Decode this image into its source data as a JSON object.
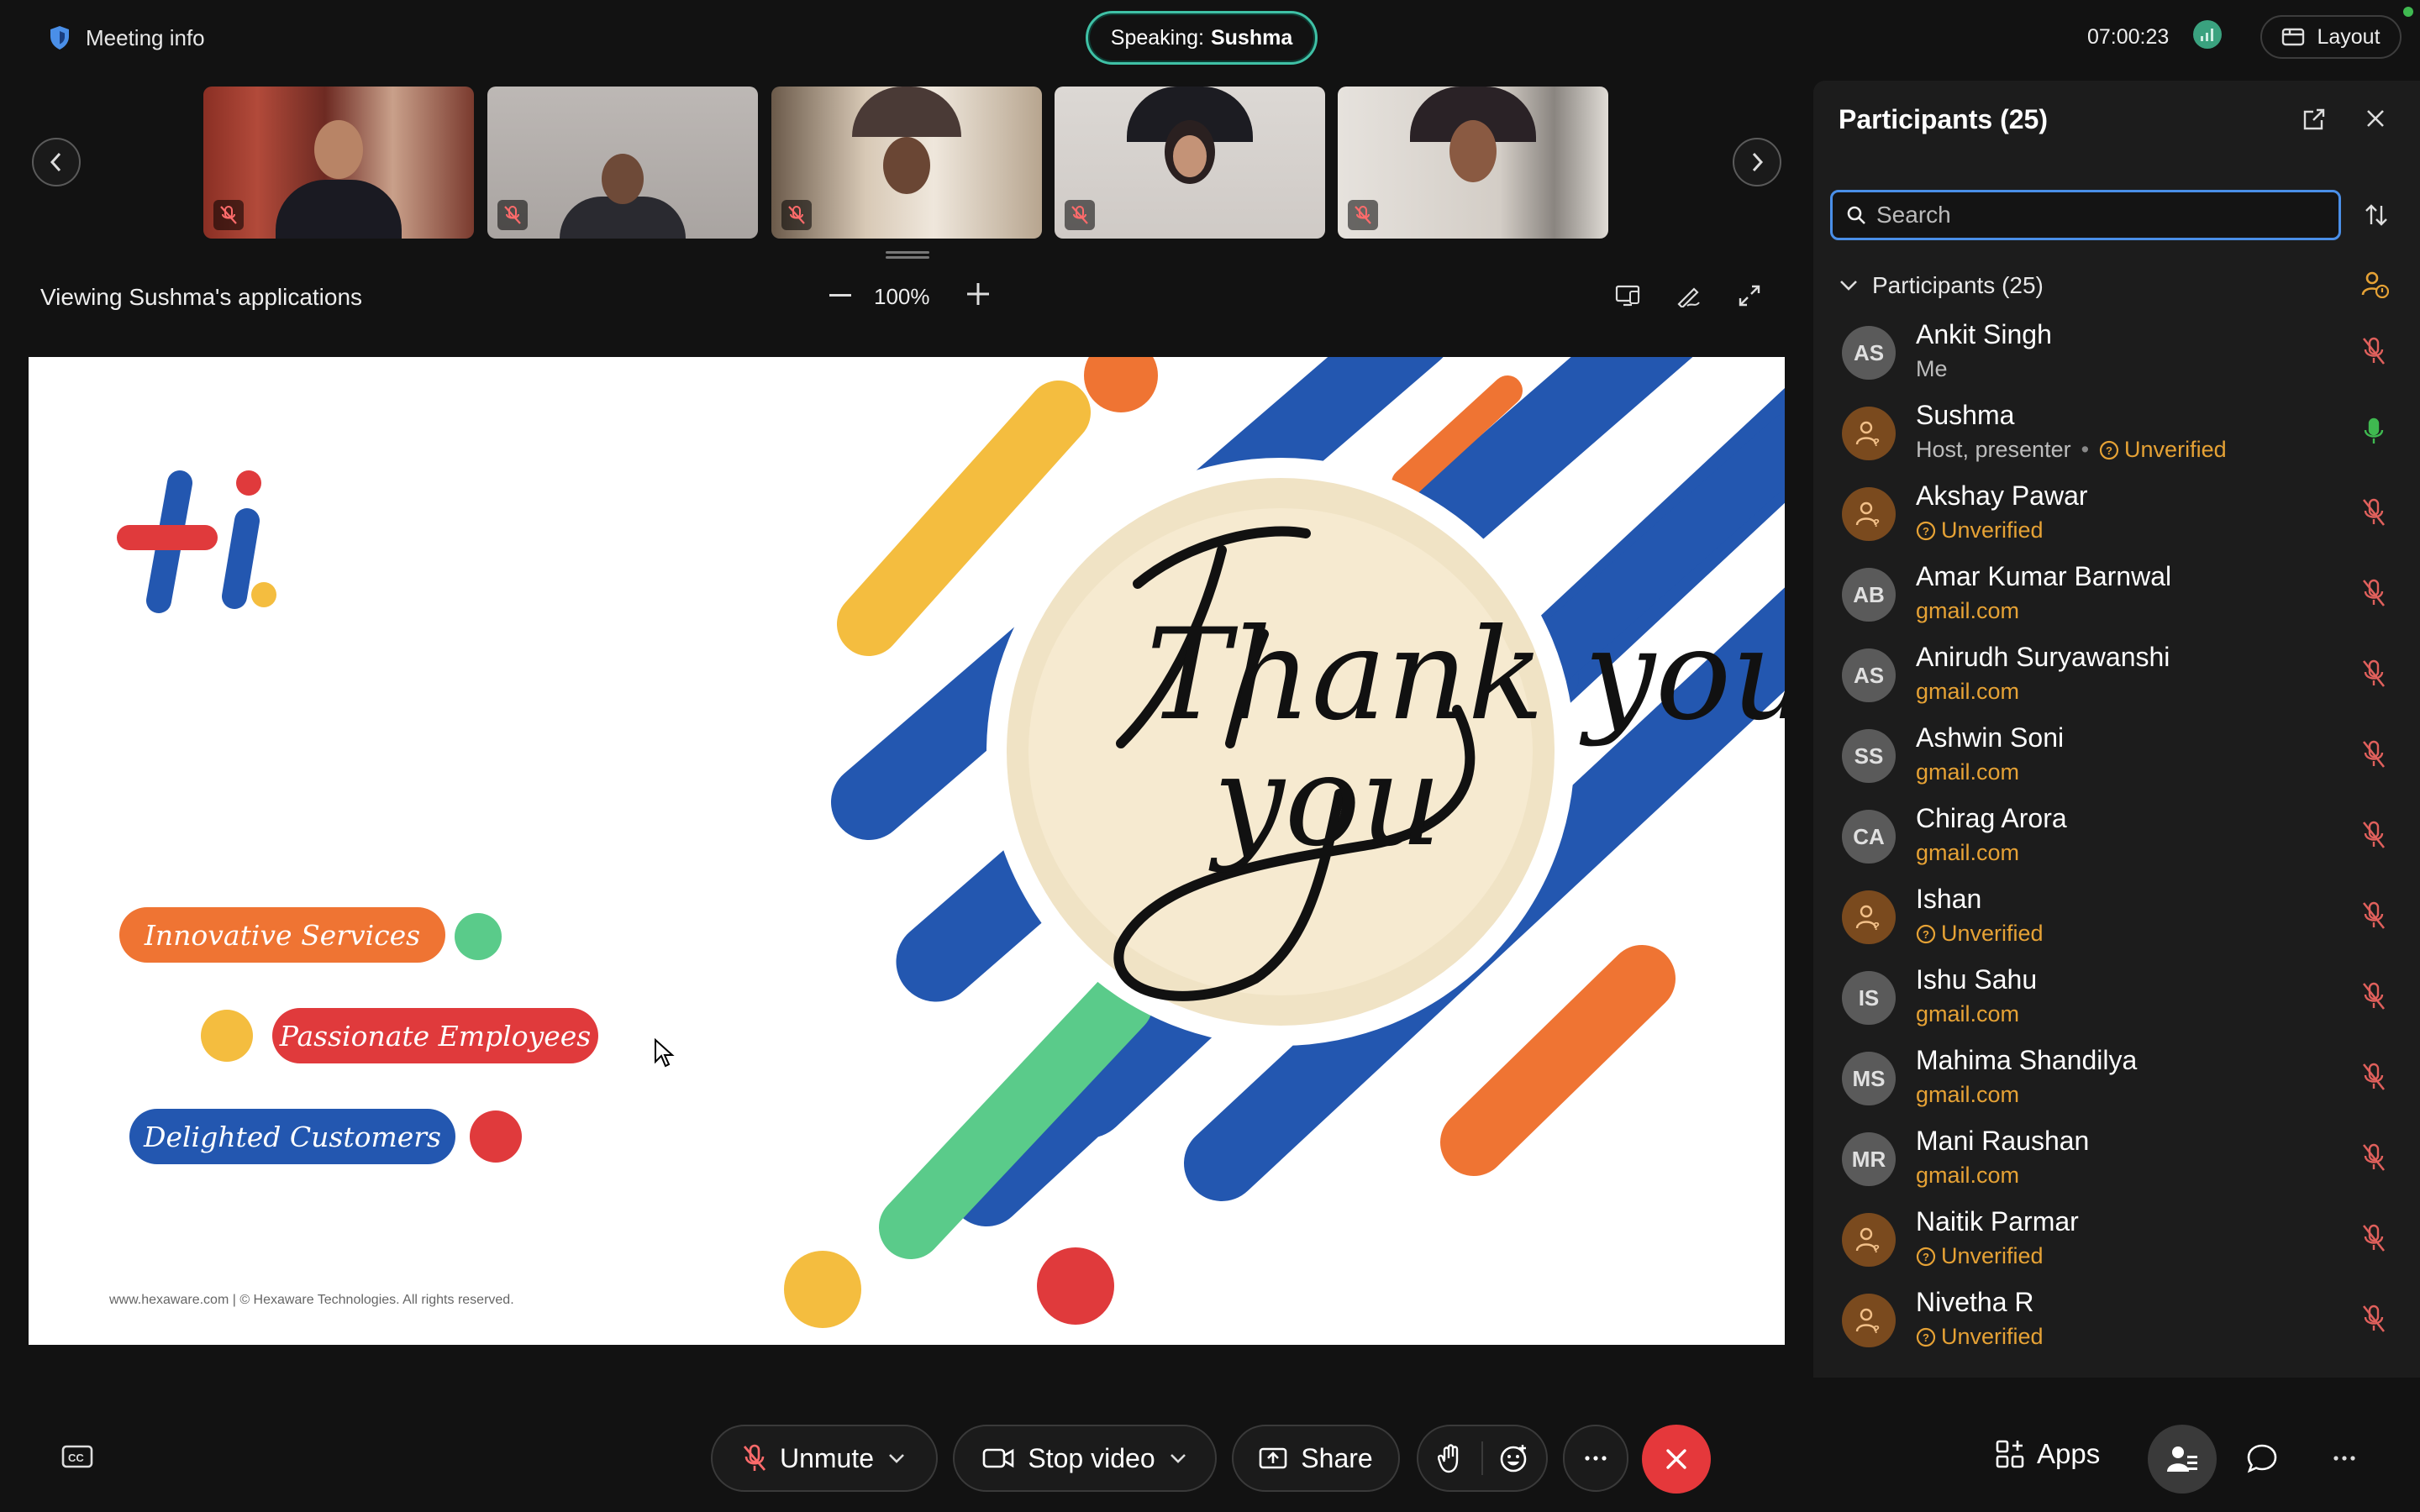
{
  "header": {
    "meeting_info_label": "Meeting info",
    "speaking_prefix": "Speaking:",
    "speaking_name": "Sushma",
    "timer": "07:00:23",
    "layout_label": "Layout"
  },
  "viewing": {
    "label": "Viewing Sushma's applications",
    "zoom": "100%"
  },
  "slide": {
    "pill_innovative": "Innovative Services",
    "pill_passionate": "Passionate Employees",
    "pill_delighted": "Delighted Customers",
    "footer": "www.hexaware.com  | © Hexaware Technologies. All rights reserved.",
    "logo_text": "hi.",
    "thank_you_text": "Thank you",
    "colors": {
      "blue": "#2357b0",
      "orange": "#ef7433",
      "yellow": "#f4bd3f",
      "red": "#e03a3c",
      "green": "#5acb8a"
    }
  },
  "participants_panel": {
    "title": "Participants (25)",
    "search_placeholder": "Search",
    "section_label": "Participants (25)",
    "items": [
      {
        "initials": "AS",
        "name": "Ankit Singh",
        "sub": "Me",
        "sub_type": "grey",
        "guest": false,
        "mic": "muted"
      },
      {
        "initials": "",
        "name": "Sushma",
        "sub": "Host, presenter",
        "sub_type": "grey",
        "unverified": "Unverified",
        "guest": true,
        "mic": "active"
      },
      {
        "initials": "",
        "name": "Akshay Pawar",
        "unverified": "Unverified",
        "guest": true,
        "mic": "muted"
      },
      {
        "initials": "AB",
        "name": "Amar Kumar Barnwal",
        "sub": "gmail.com",
        "sub_type": "orange",
        "guest": false,
        "mic": "muted"
      },
      {
        "initials": "AS",
        "name": "Anirudh Suryawanshi",
        "sub": "gmail.com",
        "sub_type": "orange",
        "guest": false,
        "mic": "muted"
      },
      {
        "initials": "SS",
        "name": "Ashwin Soni",
        "sub": "gmail.com",
        "sub_type": "orange",
        "guest": false,
        "mic": "muted"
      },
      {
        "initials": "CA",
        "name": "Chirag Arora",
        "sub": "gmail.com",
        "sub_type": "orange",
        "guest": false,
        "mic": "muted"
      },
      {
        "initials": "",
        "name": "Ishan",
        "unverified": "Unverified",
        "guest": true,
        "mic": "muted"
      },
      {
        "initials": "IS",
        "name": "Ishu Sahu",
        "sub": "gmail.com",
        "sub_type": "orange",
        "guest": false,
        "mic": "muted"
      },
      {
        "initials": "MS",
        "name": "Mahima Shandilya",
        "sub": "gmail.com",
        "sub_type": "orange",
        "guest": false,
        "mic": "muted"
      },
      {
        "initials": "MR",
        "name": "Mani Raushan",
        "sub": "gmail.com",
        "sub_type": "orange",
        "guest": false,
        "mic": "muted"
      },
      {
        "initials": "",
        "name": "Naitik Parmar",
        "unverified": "Unverified",
        "guest": true,
        "mic": "muted"
      },
      {
        "initials": "",
        "name": "Nivetha R",
        "unverified": "Unverified",
        "guest": true,
        "mic": "muted"
      }
    ]
  },
  "bottom_bar": {
    "unmute_label": "Unmute",
    "stop_video_label": "Stop video",
    "share_label": "Share",
    "apps_label": "Apps"
  }
}
